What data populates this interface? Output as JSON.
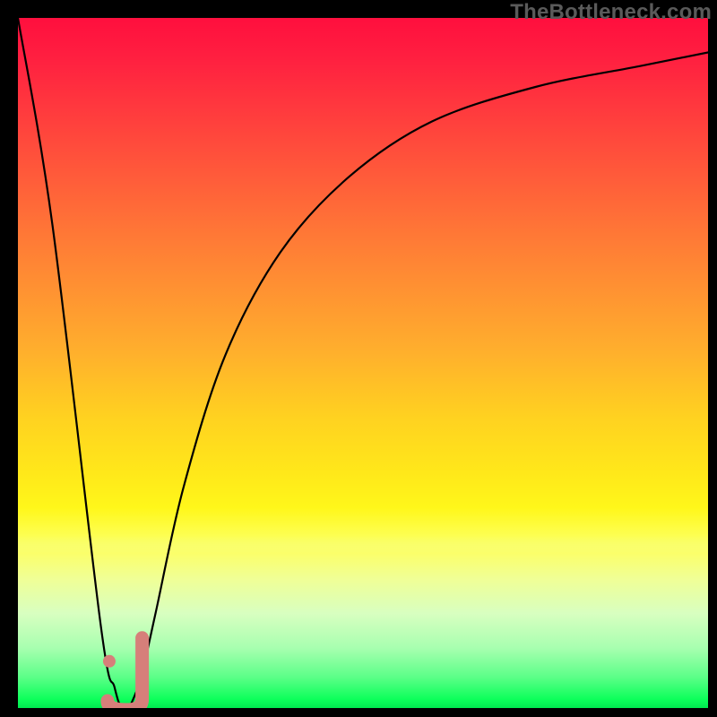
{
  "watermark": "TheBottleneck.com",
  "chart_data": {
    "type": "line",
    "title": "",
    "xlabel": "",
    "ylabel": "",
    "xlim": [
      0,
      100
    ],
    "ylim": [
      0,
      100
    ],
    "grid": false,
    "series": [
      {
        "name": "bottleneck-curve",
        "x": [
          0,
          5,
          12,
          14,
          15,
          16,
          17,
          18,
          20,
          24,
          30,
          38,
          48,
          60,
          75,
          90,
          100
        ],
        "values": [
          100,
          70,
          12,
          3,
          0,
          0,
          2,
          5,
          14,
          32,
          51,
          66,
          77,
          85,
          90,
          93,
          95
        ]
      }
    ],
    "annotations": [
      {
        "name": "j-marker",
        "type": "marker",
        "x_range": [
          13.5,
          18
        ],
        "y_range": [
          0,
          6
        ],
        "color": "#d67f7a"
      }
    ],
    "background": {
      "type": "vertical-gradient",
      "stops": [
        {
          "pos": 0.0,
          "color": "#ff0f3e"
        },
        {
          "pos": 0.18,
          "color": "#ff4a3c"
        },
        {
          "pos": 0.48,
          "color": "#ffae2d"
        },
        {
          "pos": 0.66,
          "color": "#ffe81a"
        },
        {
          "pos": 0.8,
          "color": "#e0ffb0"
        },
        {
          "pos": 0.92,
          "color": "#56ff7a"
        },
        {
          "pos": 1.0,
          "color": "#00f050"
        }
      ]
    }
  },
  "colors": {
    "curve": "#000000",
    "marker": "#d67f7a",
    "watermark": "#5a5a5a",
    "frame": "#000000"
  }
}
